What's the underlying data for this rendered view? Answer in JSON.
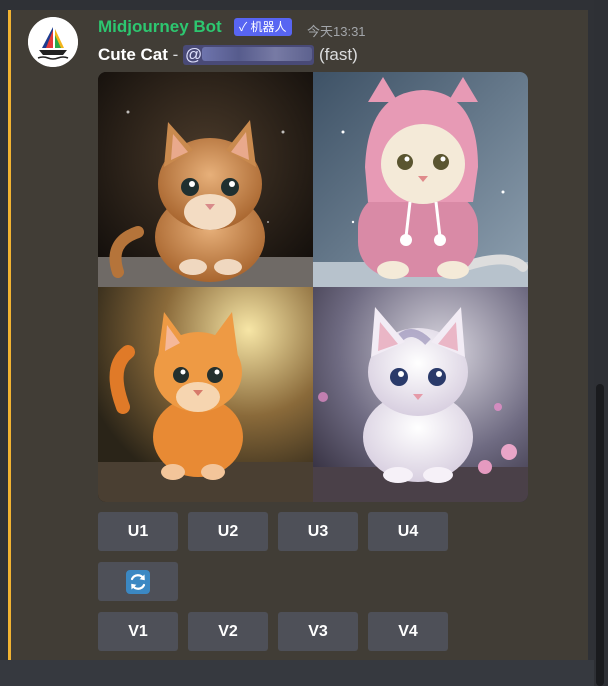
{
  "message": {
    "author": "Midjourney Bot",
    "badge": "✓ 机器人",
    "timestamp": "今天13:31",
    "prompt": "Cute Cat",
    "separator": " - ",
    "mention_prefix": "@",
    "speed": "(fast)"
  },
  "image_grid": {
    "alt": "Four generated images of cute kittens",
    "tiles": [
      {
        "name": "image-tile-1",
        "subject": "orange-kitten-dark-background"
      },
      {
        "name": "image-tile-2",
        "subject": "kitten-in-pink-hoodie"
      },
      {
        "name": "image-tile-3",
        "subject": "orange-kitten-sunlit"
      },
      {
        "name": "image-tile-4",
        "subject": "white-kitten-flowers"
      }
    ]
  },
  "buttons": {
    "upscale": [
      "U1",
      "U2",
      "U3",
      "U4"
    ],
    "reroll_icon": "refresh-icon",
    "variation": [
      "V1",
      "V2",
      "V3",
      "V4"
    ]
  },
  "colors": {
    "author": "#2dc770",
    "badge": "#5865f2",
    "accent_bar": "#f0b232",
    "message_bg": "#413d36",
    "button_bg": "#4e5058",
    "refresh_icon": "#3b88c3"
  }
}
